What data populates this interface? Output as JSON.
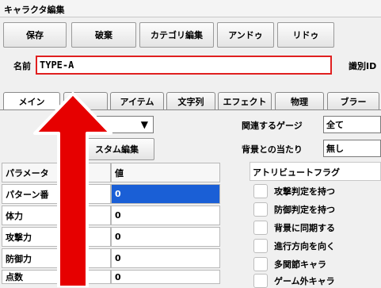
{
  "window": {
    "title": "キャラクタ編集"
  },
  "toolbar": {
    "save": "保存",
    "discard": "破棄",
    "category_edit": "カテゴリ編集",
    "undo": "アンドゥ",
    "redo": "リドゥ"
  },
  "name": {
    "label": "名前",
    "value": "TYPE-A"
  },
  "id_field": {
    "label": "識別ID"
  },
  "tabs": [
    {
      "label": "メイン"
    },
    {
      "label": "アイテム"
    },
    {
      "label": "文字列"
    },
    {
      "label": "エフェクト"
    },
    {
      "label": "物理"
    },
    {
      "label": "ブラー"
    }
  ],
  "main": {
    "type_select": {
      "value": ")",
      "arrow": "▼"
    },
    "custom_edit_button": "スタム編集",
    "related_gauge": {
      "label": "関連するゲージ",
      "value": "全て"
    },
    "bg_hit": {
      "label": "背景との当たり",
      "value": "無し"
    }
  },
  "params": {
    "headers": [
      "パラメータ",
      "値"
    ],
    "rows": [
      {
        "name": "パターン番",
        "value": "0"
      },
      {
        "name": "体力",
        "value": "0"
      },
      {
        "name": "攻撃力",
        "value": "0"
      },
      {
        "name": "防御力",
        "value": "0"
      },
      {
        "name": "点数",
        "value": "0"
      }
    ]
  },
  "attributes": {
    "title": "アトリビュートフラグ",
    "flags": [
      {
        "label": "攻撃判定を持つ"
      },
      {
        "label": "防御判定を持つ"
      },
      {
        "label": "背景に同期する"
      },
      {
        "label": "進行方向を向く"
      },
      {
        "label": "多関節キャラ"
      },
      {
        "label": "ゲーム外キャラ"
      }
    ]
  },
  "annotation": {
    "arrow_color": "#e60000"
  }
}
